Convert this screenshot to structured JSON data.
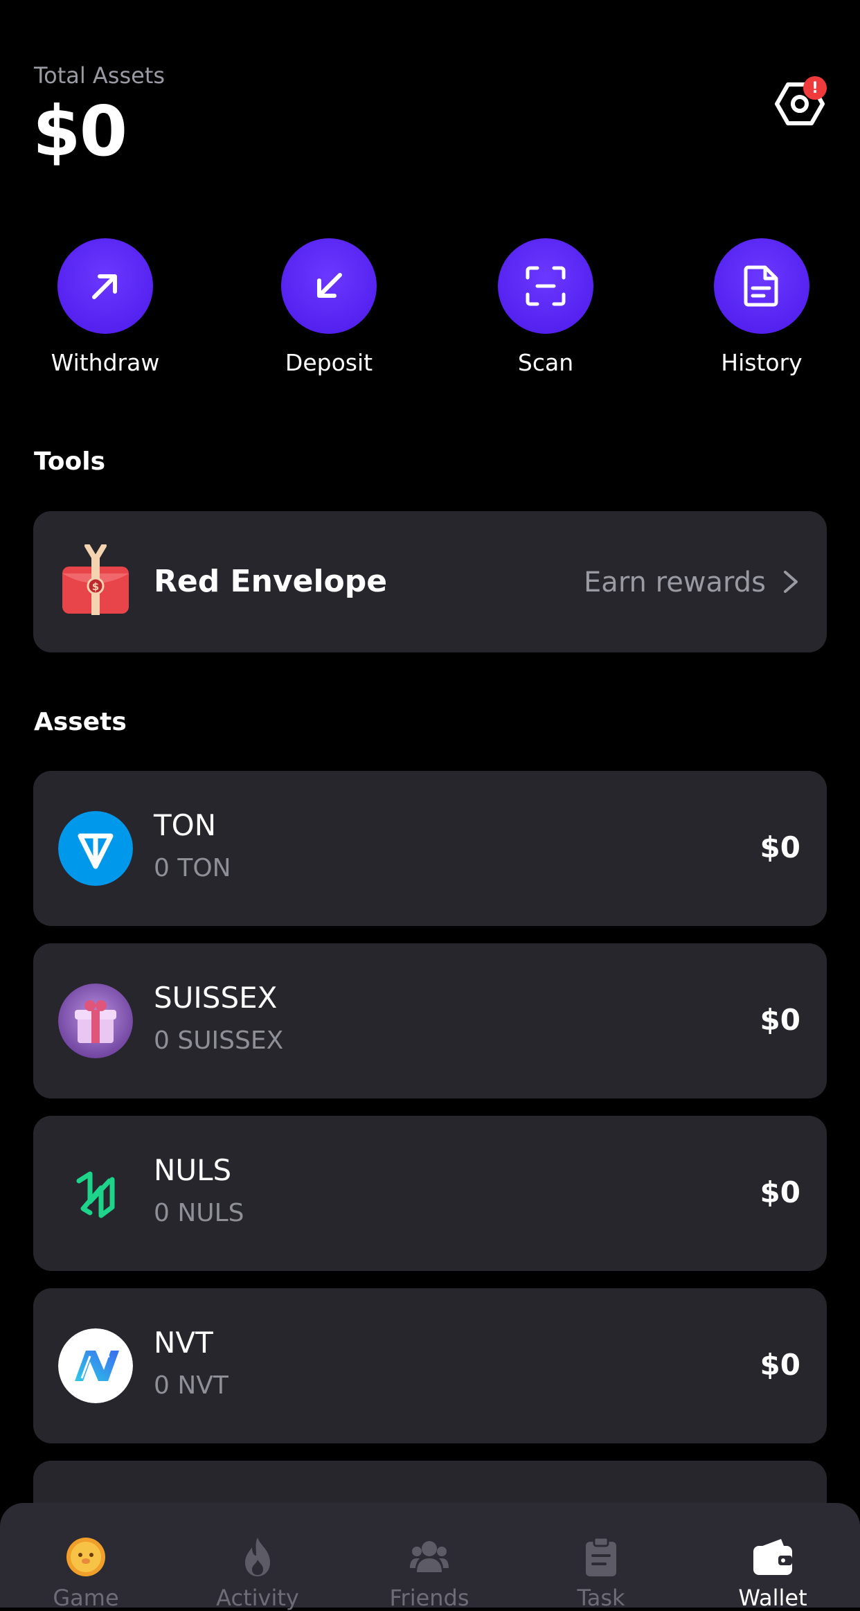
{
  "header": {
    "total_label": "Total Assets",
    "total_value": "$0",
    "settings_badge": "!"
  },
  "actions": [
    {
      "label": "Withdraw",
      "icon": "arrow-up-right-icon"
    },
    {
      "label": "Deposit",
      "icon": "arrow-down-left-icon"
    },
    {
      "label": "Scan",
      "icon": "scan-icon"
    },
    {
      "label": "History",
      "icon": "document-icon"
    }
  ],
  "tools": {
    "title": "Tools",
    "red_envelope": {
      "title": "Red Envelope",
      "subtitle": "Earn rewards",
      "icon": "red-envelope-icon"
    }
  },
  "assets": {
    "title": "Assets",
    "items": [
      {
        "name": "TON",
        "amount": "0 TON",
        "value": "$0",
        "icon": "ton-logo-icon"
      },
      {
        "name": "SUISSEX",
        "amount": "0 SUISSEX",
        "value": "$0",
        "icon": "gift-box-icon"
      },
      {
        "name": "NULS",
        "amount": "0 NULS",
        "value": "$0",
        "icon": "nuls-logo-icon"
      },
      {
        "name": "NVT",
        "amount": "0 NVT",
        "value": "$0",
        "icon": "nvt-logo-icon"
      }
    ]
  },
  "nav": {
    "items": [
      {
        "label": "Game",
        "icon": "coin-face-icon",
        "active": false
      },
      {
        "label": "Activity",
        "icon": "flame-icon",
        "active": false
      },
      {
        "label": "Friends",
        "icon": "friends-icon",
        "active": false
      },
      {
        "label": "Task",
        "icon": "clipboard-icon",
        "active": false
      },
      {
        "label": "Wallet",
        "icon": "wallet-icon",
        "active": true
      }
    ]
  },
  "colors": {
    "background": "#000000",
    "card": "#27262d",
    "accent": "#5a27f5",
    "muted_text": "#9a9aa3",
    "badge": "#ef3b3b",
    "ton_blue": "#0098ea",
    "nuls_green": "#1ed48a"
  }
}
